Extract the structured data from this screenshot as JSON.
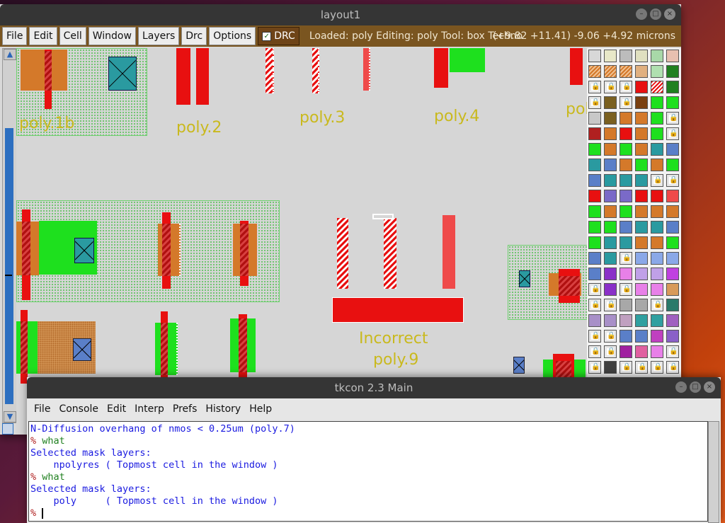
{
  "layout_window": {
    "title": "layout1",
    "menu": [
      "File",
      "Edit",
      "Cell",
      "Window",
      "Layers",
      "Drc",
      "Options"
    ],
    "drc_label": "DRC",
    "status": "Loaded: poly Editing: poly Tool: box  Techno",
    "coords": "(+9.82 +11.41) -9.06 +4.92 microns"
  },
  "canvas_labels": {
    "poly1b": "poly.1b",
    "poly2": "poly.2",
    "poly3": "poly.3",
    "poly4": "poly.4",
    "poly_cut": "pol",
    "incorrect": "Incorrect",
    "poly9": "poly.9"
  },
  "tkcon": {
    "title": "tkcon 2.3 Main",
    "menu": [
      "File",
      "Console",
      "Edit",
      "Interp",
      "Prefs",
      "History",
      "Help"
    ],
    "lines": [
      {
        "kind": "out",
        "text": "N-Diffusion overhang of nmos < 0.25um (poly.7)"
      },
      {
        "kind": "cmd",
        "prompt": "% ",
        "text": "what"
      },
      {
        "kind": "out",
        "text": "Selected mask layers:"
      },
      {
        "kind": "out",
        "text": "    npolyres ( Topmost cell in the window )"
      },
      {
        "kind": "cmd",
        "prompt": "% ",
        "text": "what"
      },
      {
        "kind": "out",
        "text": "Selected mask layers:"
      },
      {
        "kind": "out",
        "text": "    poly     ( Topmost cell in the window )"
      },
      {
        "kind": "cmd",
        "prompt": "% ",
        "text": ""
      }
    ]
  },
  "colors": {
    "poly": "#e81010",
    "ndiff": "#1ee01e",
    "pdiff": "#d4792a",
    "contact": "#2a9aa0",
    "label": "#c9b91e"
  }
}
